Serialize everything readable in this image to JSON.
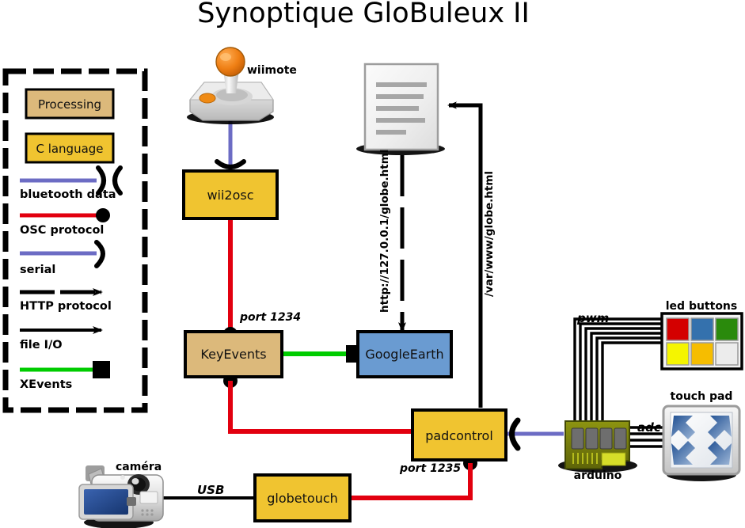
{
  "title": "Synoptique GloBuleux II",
  "legend": {
    "items": [
      {
        "kind": "box",
        "label": "Processing",
        "color": "#dcb97b"
      },
      {
        "kind": "box",
        "label": "C language",
        "color": "#f0c430"
      },
      {
        "kind": "line",
        "label": "bluetooth data",
        "color": "#6c6cc4",
        "endcap": "bluetooth-x"
      },
      {
        "kind": "line",
        "label": "OSC protocol",
        "color": "#e2000f",
        "endcap": "dot"
      },
      {
        "kind": "line",
        "label": "serial",
        "color": "#6c6cc4",
        "endcap": "serial-c"
      },
      {
        "kind": "line",
        "label": "HTTP protocol",
        "color": "#000000",
        "endcap": "dashed-arrow"
      },
      {
        "kind": "line",
        "label": "file I/O",
        "color": "#000000",
        "endcap": "arrow"
      },
      {
        "kind": "line",
        "label": "XEvents",
        "color": "#00cc00",
        "endcap": "square"
      }
    ]
  },
  "nodes": {
    "wii2osc": {
      "label": "wii2osc",
      "color": "#f0c430"
    },
    "keyevents": {
      "label": "KeyEvents",
      "color": "#dcb97b"
    },
    "googleearth": {
      "label": "GoogleEarth",
      "color": "#6a9bd1"
    },
    "padcontrol": {
      "label": "padcontrol",
      "color": "#f0c430"
    },
    "globetouch": {
      "label": "globetouch",
      "color": "#f0c430"
    }
  },
  "devices": {
    "wiimote": {
      "label": "wiimote"
    },
    "camera": {
      "label": "caméra"
    },
    "arduino": {
      "label": "arduino"
    },
    "led_buttons": {
      "label": "led buttons",
      "colors": [
        "#d40000",
        "#3471ad",
        "#2a8a0c",
        "#f5f500",
        "#f6bd00",
        "#ececec"
      ]
    },
    "touchpad": {
      "label": "touch pad"
    },
    "document": {
      "label": ""
    }
  },
  "edge_labels": {
    "http_url": "http://127.0.0.1/globe.html",
    "file_path": "/var/www/globe.html",
    "port1234": "port 1234",
    "port1235": "port 1235",
    "usb": "USB",
    "pwm": "pwm",
    "adc": "adc"
  },
  "colors": {
    "osc_red": "#e2000f",
    "bluetooth_blue": "#6c6cc4",
    "serial_blue": "#6c6cc4",
    "xevents_green": "#00cc00",
    "black": "#000000"
  }
}
